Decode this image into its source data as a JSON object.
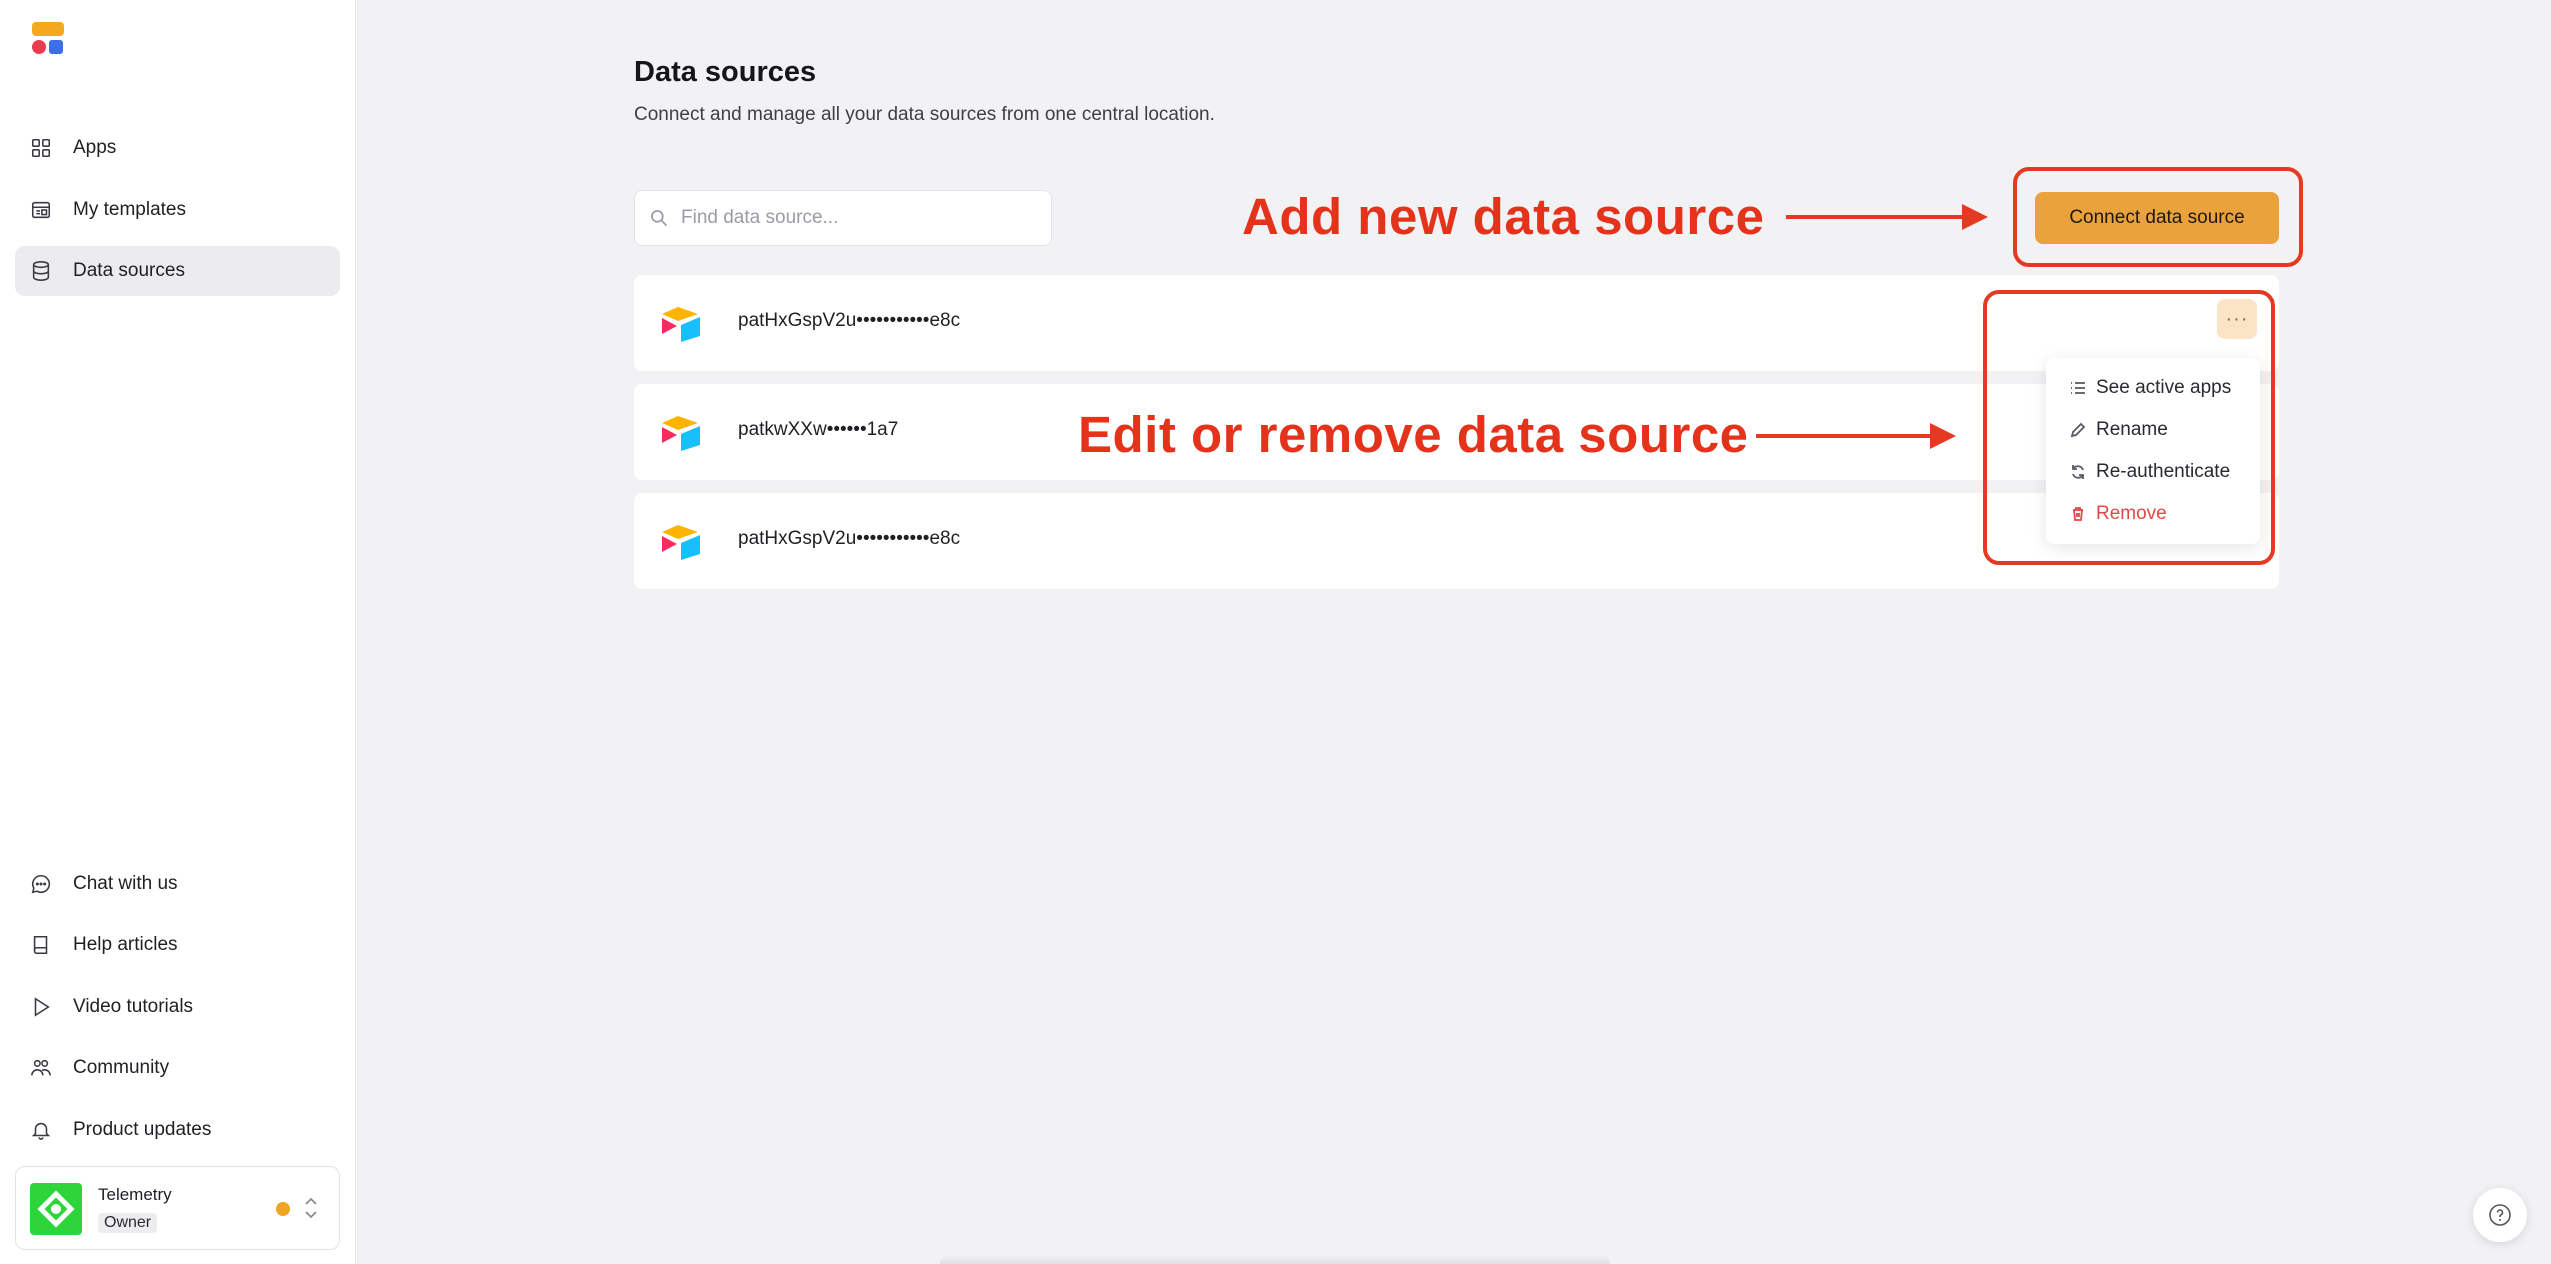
{
  "sidebar": {
    "nav": [
      {
        "label": "Apps",
        "icon": "grid-icon"
      },
      {
        "label": "My templates",
        "icon": "templates-icon"
      },
      {
        "label": "Data sources",
        "icon": "database-icon",
        "active": true
      }
    ],
    "bottom_nav": [
      {
        "label": "Chat with us",
        "icon": "chat-icon"
      },
      {
        "label": "Help articles",
        "icon": "book-icon"
      },
      {
        "label": "Video tutorials",
        "icon": "play-icon"
      },
      {
        "label": "Community",
        "icon": "users-icon"
      },
      {
        "label": "Product updates",
        "icon": "bell-icon"
      }
    ],
    "workspace": {
      "name": "Telemetry",
      "role": "Owner",
      "status_color": "#f0a623"
    }
  },
  "main": {
    "title": "Data sources",
    "subtitle": "Connect and manage all your data sources from one central location.",
    "search_placeholder": "Find data source...",
    "connect_button": "Connect data source",
    "sources": [
      {
        "name": "patHxGspV2u•••••••••••e8c"
      },
      {
        "name": "patkwXXw••••••1a7"
      },
      {
        "name": "patHxGspV2u•••••••••••e8c"
      }
    ],
    "more_label": "···",
    "menu": [
      {
        "label": "See active apps",
        "icon": "list-icon"
      },
      {
        "label": "Rename",
        "icon": "pencil-icon"
      },
      {
        "label": "Re-authenticate",
        "icon": "refresh-icon"
      },
      {
        "label": "Remove",
        "icon": "trash-icon",
        "danger": true
      }
    ]
  },
  "annotations": {
    "add": "Add new data source",
    "edit": "Edit or remove data source",
    "color": "#e5321b"
  },
  "colors": {
    "accent": "#e9a23c",
    "danger": "#e04848",
    "workspace_avatar": "#2ed53a"
  }
}
